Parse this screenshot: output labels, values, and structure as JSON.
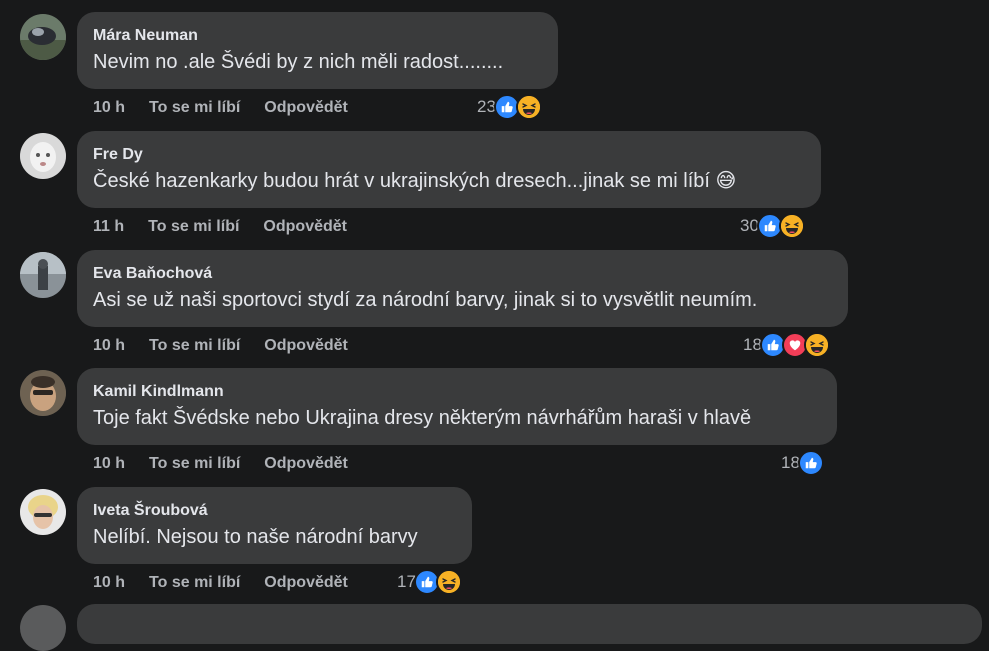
{
  "comments": [
    {
      "author": "Mára Neuman",
      "text": "Nevim no .ale Švédi by z nich měli radost........",
      "time": "10 h",
      "like_label": "To se mi líbí",
      "reply_label": "Odpovědět",
      "reaction_count": "23",
      "reactions": [
        "like",
        "haha"
      ]
    },
    {
      "author": "Fre Dy",
      "text": "České hazenkarky budou hrát v ukrajinských dresech...jinak se mi líbí 😅",
      "time": "11 h",
      "like_label": "To se mi líbí",
      "reply_label": "Odpovědět",
      "reaction_count": "30",
      "reactions": [
        "like",
        "haha"
      ]
    },
    {
      "author": "Eva Baňochová",
      "text": "Asi se už naši sportovci stydí za národní barvy, jinak si to vysvětlit neumím.",
      "time": "10 h",
      "like_label": "To se mi líbí",
      "reply_label": "Odpovědět",
      "reaction_count": "18",
      "reactions": [
        "like",
        "love",
        "haha"
      ]
    },
    {
      "author": "Kamil Kindlmann",
      "text": "Toje fakt Švédske nebo Ukrajina dresy některým návrhářům haraši v hlavě",
      "time": "10 h",
      "like_label": "To se mi líbí",
      "reply_label": "Odpovědět",
      "reaction_count": "18",
      "reactions": [
        "like"
      ]
    },
    {
      "author": "Iveta Šroubová",
      "text": "Nelíbí. Nejsou to naše národní barvy",
      "time": "10 h",
      "like_label": "To se mi líbí",
      "reply_label": "Odpovědět",
      "reaction_count": "17",
      "reactions": [
        "like",
        "haha"
      ]
    }
  ],
  "colors": {
    "background": "#18191a",
    "bubble": "#3a3b3c",
    "text_primary": "#e4e6eb",
    "text_secondary": "#b0b3b8",
    "like_blue": "#2d88ff",
    "love_red": "#f33e58",
    "haha_yellow": "#f7b125"
  },
  "icons": {
    "like": "thumbs-up-icon",
    "love": "heart-icon",
    "haha": "laughing-face-icon"
  }
}
